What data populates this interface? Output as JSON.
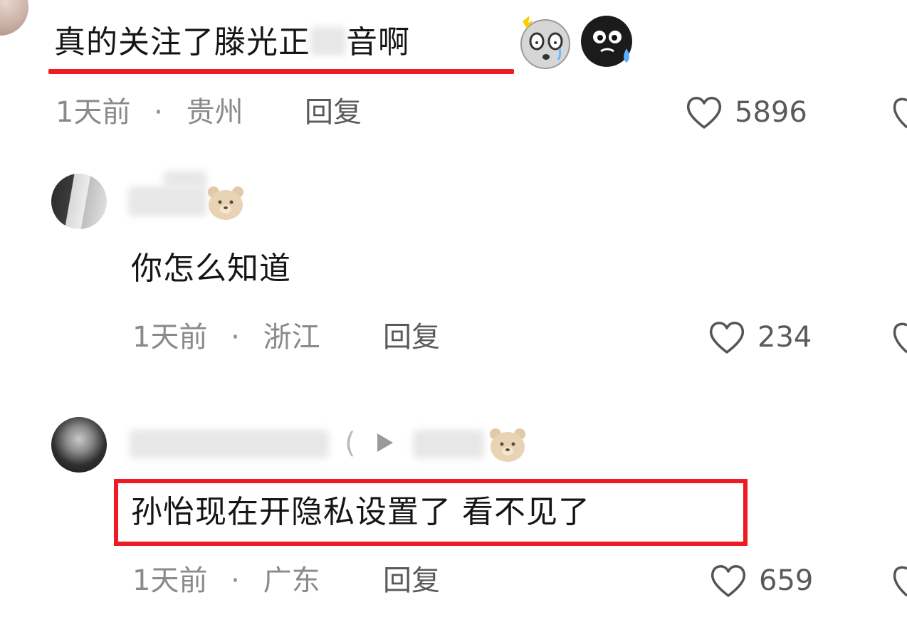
{
  "comments": [
    {
      "text_before": "真的关注了滕光正",
      "text_after": "音啊",
      "time": "1天前",
      "separator": "·",
      "location": "贵州",
      "reply_label": "回复",
      "likes": "5896"
    },
    {
      "text": "你怎么知道",
      "time": "1天前",
      "separator": "·",
      "location": "浙江",
      "reply_label": "回复",
      "likes": "234"
    },
    {
      "text": "孙怡现在开隐私设置了 看不见了",
      "time": "1天前",
      "separator": "·",
      "location": "广东",
      "reply_label": "回复",
      "likes": "659"
    }
  ],
  "emojis": [
    "shocked-emoji",
    "sweat-emoji",
    "bear-emoji",
    "play-icon",
    "heart-icon"
  ],
  "colors": {
    "highlight_red": "#ee1b24",
    "meta_gray": "#8a8a8a",
    "text_dark": "#151515"
  }
}
